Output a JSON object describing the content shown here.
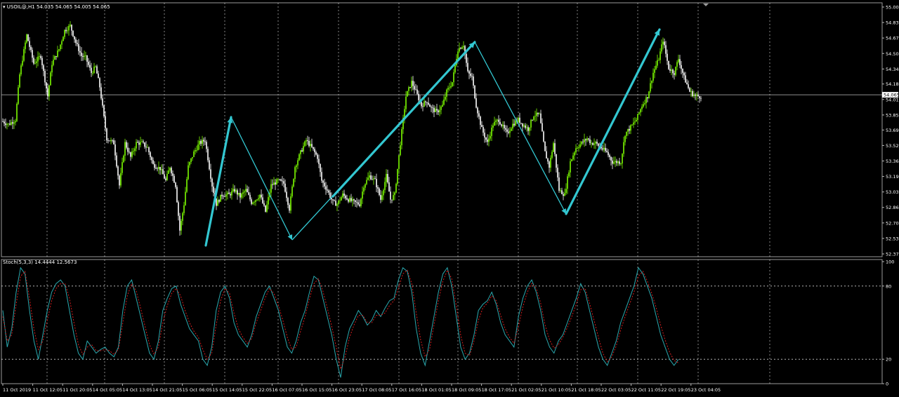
{
  "main_header": {
    "symbol": "USOIL@,H1",
    "open": "54.035",
    "high": "54.065",
    "low": "54.005",
    "close": "54.065"
  },
  "stoch_header": {
    "label": "Stoch(5,3,3)",
    "main_value": "14.4444",
    "signal_value": "12.5673"
  },
  "colors": {
    "background": "#000000",
    "bull_candle": "#7CFC00",
    "bear_candle": "#FFFFFF",
    "wave_arrows": "#33C7D1",
    "stoch_main": "#2AA8AE",
    "stoch_signal": "#D11E1E",
    "grid": "#CFCFCF",
    "axis_text": "#FFFFFF"
  },
  "chart_data": [
    {
      "type": "candlestick",
      "title": "USOIL@,H1",
      "ylim": [
        52.37,
        55.0
      ],
      "y_ticks": [
        "55.000",
        "54.835",
        "54.670",
        "54.505",
        "54.340",
        "54.180",
        "54.015",
        "53.850",
        "53.690",
        "53.525",
        "53.360",
        "53.195",
        "53.030",
        "52.865",
        "52.700",
        "52.535",
        "52.370"
      ],
      "current_price": "54.065",
      "grid": true,
      "x_ticks": [
        "11 Oct 2019",
        "11 Oct 12:05",
        "11 Oct 20:05",
        "14 Oct 05:05",
        "14 Oct 13:05",
        "14 Oct 21:05",
        "15 Oct 06:05",
        "15 Oct 14:05",
        "15 Oct 22:05",
        "16 Oct 07:05",
        "16 Oct 15:05",
        "16 Oct 23:05",
        "17 Oct 08:05",
        "17 Oct 16:05",
        "18 Oct 01:05",
        "18 Oct 09:05",
        "18 Oct 17:05",
        "21 Oct 02:05",
        "21 Oct 10:05",
        "21 Oct 18:05",
        "22 Oct 03:05",
        "22 Oct 11:05",
        "22 Oct 19:05",
        "23 Oct 04:05"
      ],
      "close_path": [
        [
          0,
          53.78
        ],
        [
          4,
          53.75
        ],
        [
          9,
          53.8
        ],
        [
          12,
          54.28
        ],
        [
          17,
          54.7
        ],
        [
          22,
          54.4
        ],
        [
          27,
          54.48
        ],
        [
          32,
          54.05
        ],
        [
          35,
          54.4
        ],
        [
          40,
          54.55
        ],
        [
          44,
          54.75
        ],
        [
          48,
          54.8
        ],
        [
          52,
          54.62
        ],
        [
          56,
          54.48
        ],
        [
          59,
          54.46
        ],
        [
          63,
          54.3
        ],
        [
          66,
          54.36
        ],
        [
          69,
          54.15
        ],
        [
          74,
          53.6
        ],
        [
          79,
          53.55
        ],
        [
          83,
          53.1
        ],
        [
          87,
          53.55
        ],
        [
          91,
          53.4
        ],
        [
          95,
          53.55
        ],
        [
          99,
          53.55
        ],
        [
          103,
          53.5
        ],
        [
          107,
          53.32
        ],
        [
          112,
          53.28
        ],
        [
          116,
          53.15
        ],
        [
          119,
          53.3
        ],
        [
          123,
          53.1
        ],
        [
          126,
          52.62
        ],
        [
          129,
          52.9
        ],
        [
          132,
          53.3
        ],
        [
          136,
          53.45
        ],
        [
          140,
          53.55
        ],
        [
          144,
          53.58
        ],
        [
          149,
          53.1
        ],
        [
          152,
          52.9
        ],
        [
          156,
          53.0
        ],
        [
          161,
          53.0
        ],
        [
          165,
          53.05
        ],
        [
          169,
          52.98
        ],
        [
          173,
          53.05
        ],
        [
          177,
          52.92
        ],
        [
          180,
          52.95
        ],
        [
          183,
          53.0
        ],
        [
          187,
          52.82
        ],
        [
          191,
          53.1
        ],
        [
          196,
          53.15
        ],
        [
          200,
          53.12
        ],
        [
          204,
          52.85
        ],
        [
          208,
          53.3
        ],
        [
          212,
          53.45
        ],
        [
          216,
          53.58
        ],
        [
          220,
          53.5
        ],
        [
          224,
          53.4
        ],
        [
          227,
          53.15
        ],
        [
          231,
          53.05
        ],
        [
          235,
          52.92
        ],
        [
          238,
          52.9
        ],
        [
          242,
          53.0
        ],
        [
          246,
          52.95
        ],
        [
          250,
          52.92
        ],
        [
          254,
          52.9
        ],
        [
          257,
          53.1
        ],
        [
          261,
          53.2
        ],
        [
          265,
          53.15
        ],
        [
          269,
          52.95
        ],
        [
          273,
          53.2
        ],
        [
          276,
          52.95
        ],
        [
          279,
          53.0
        ],
        [
          283,
          53.55
        ],
        [
          287,
          54.05
        ],
        [
          291,
          54.2
        ],
        [
          294,
          54.1
        ],
        [
          298,
          53.95
        ],
        [
          302,
          54.0
        ],
        [
          305,
          53.92
        ],
        [
          309,
          53.88
        ],
        [
          313,
          53.95
        ],
        [
          316,
          54.1
        ],
        [
          320,
          54.2
        ],
        [
          324,
          54.55
        ],
        [
          328,
          54.6
        ],
        [
          331,
          54.3
        ],
        [
          334,
          54.25
        ],
        [
          337,
          53.95
        ],
        [
          341,
          53.7
        ],
        [
          345,
          53.55
        ],
        [
          349,
          53.75
        ],
        [
          353,
          53.8
        ],
        [
          356,
          53.72
        ],
        [
          359,
          53.65
        ],
        [
          363,
          53.75
        ],
        [
          367,
          53.8
        ],
        [
          370,
          53.75
        ],
        [
          374,
          53.7
        ],
        [
          378,
          53.85
        ],
        [
          382,
          53.85
        ],
        [
          386,
          53.45
        ],
        [
          389,
          53.3
        ],
        [
          392,
          53.55
        ],
        [
          396,
          53.05
        ],
        [
          400,
          53.0
        ],
        [
          404,
          53.35
        ],
        [
          408,
          53.5
        ],
        [
          412,
          53.55
        ],
        [
          416,
          53.6
        ],
        [
          419,
          53.55
        ],
        [
          422,
          53.55
        ],
        [
          426,
          53.5
        ],
        [
          430,
          53.45
        ],
        [
          434,
          53.35
        ],
        [
          437,
          53.35
        ],
        [
          440,
          53.35
        ],
        [
          443,
          53.65
        ],
        [
          447,
          53.72
        ],
        [
          451,
          53.8
        ],
        [
          455,
          53.95
        ],
        [
          459,
          54.05
        ],
        [
          463,
          54.3
        ],
        [
          467,
          54.45
        ],
        [
          470,
          54.65
        ],
        [
          474,
          54.35
        ],
        [
          478,
          54.3
        ],
        [
          481,
          54.45
        ],
        [
          485,
          54.25
        ],
        [
          489,
          54.1
        ],
        [
          493,
          54.05
        ],
        [
          497,
          54.05
        ]
      ]
    },
    {
      "type": "line",
      "title": "Stoch(5,3,3) 14.4444 12.5673",
      "ylim": [
        0,
        100
      ],
      "y_ticks": [
        "100",
        "80",
        "20",
        "0"
      ],
      "grid": true,
      "series": [
        {
          "values": [
            60,
            30,
            45,
            75,
            95,
            90,
            60,
            35,
            20,
            40,
            60,
            75,
            82,
            85,
            80,
            60,
            40,
            25,
            20,
            35,
            30,
            25,
            28,
            30,
            25,
            22,
            30,
            60,
            80,
            85,
            70,
            55,
            40,
            25,
            20,
            35,
            60,
            70,
            78,
            80,
            65,
            55,
            45,
            40,
            35,
            20,
            15,
            30,
            60,
            75,
            80,
            70,
            50,
            40,
            35,
            30,
            40,
            55,
            65,
            75,
            80,
            70,
            60,
            45,
            30,
            25,
            35,
            50,
            60,
            75,
            88,
            85,
            70,
            55,
            40,
            20,
            5,
            30,
            45,
            52,
            60,
            55,
            48,
            52,
            60,
            55,
            62,
            68,
            70,
            85,
            95,
            92,
            75,
            45,
            25,
            15,
            35,
            55,
            75,
            90,
            95,
            80,
            55,
            30,
            20,
            25,
            40,
            60,
            65,
            68,
            75,
            65,
            50,
            40,
            35,
            30,
            55,
            70,
            80,
            85,
            75,
            60,
            40,
            30,
            25,
            35,
            40,
            50,
            60,
            70,
            82,
            75,
            60,
            45,
            30,
            20,
            15,
            25,
            35,
            50,
            60,
            70,
            80,
            95,
            90,
            80,
            70,
            55,
            40,
            30,
            20,
            15,
            20
          ]
        },
        {
          "values": [
            55,
            35,
            40,
            65,
            88,
            92,
            70,
            45,
            28,
            35,
            52,
            68,
            78,
            82,
            82,
            70,
            50,
            32,
            24,
            30,
            32,
            27,
            27,
            28,
            27,
            24,
            28,
            50,
            72,
            82,
            76,
            62,
            47,
            32,
            24,
            30,
            50,
            64,
            74,
            78,
            72,
            60,
            50,
            43,
            38,
            28,
            20,
            25,
            48,
            68,
            78,
            74,
            58,
            45,
            38,
            33,
            37,
            50,
            60,
            70,
            78,
            74,
            64,
            52,
            38,
            28,
            30,
            43,
            55,
            70,
            82,
            86,
            76,
            62,
            47,
            30,
            12,
            22,
            38,
            48,
            56,
            56,
            50,
            50,
            56,
            56,
            58,
            64,
            68,
            78,
            90,
            93,
            82,
            58,
            36,
            22,
            28,
            48,
            68,
            84,
            93,
            86,
            64,
            40,
            25,
            23,
            35,
            52,
            62,
            66,
            72,
            68,
            56,
            45,
            38,
            33,
            47,
            63,
            75,
            82,
            78,
            66,
            48,
            36,
            29,
            32,
            38,
            46,
            55,
            65,
            77,
            78,
            66,
            52,
            38,
            25,
            18,
            22,
            31,
            44,
            55,
            65,
            75,
            88,
            92,
            84,
            74,
            62,
            48,
            36,
            26,
            19,
            17
          ]
        }
      ]
    }
  ]
}
